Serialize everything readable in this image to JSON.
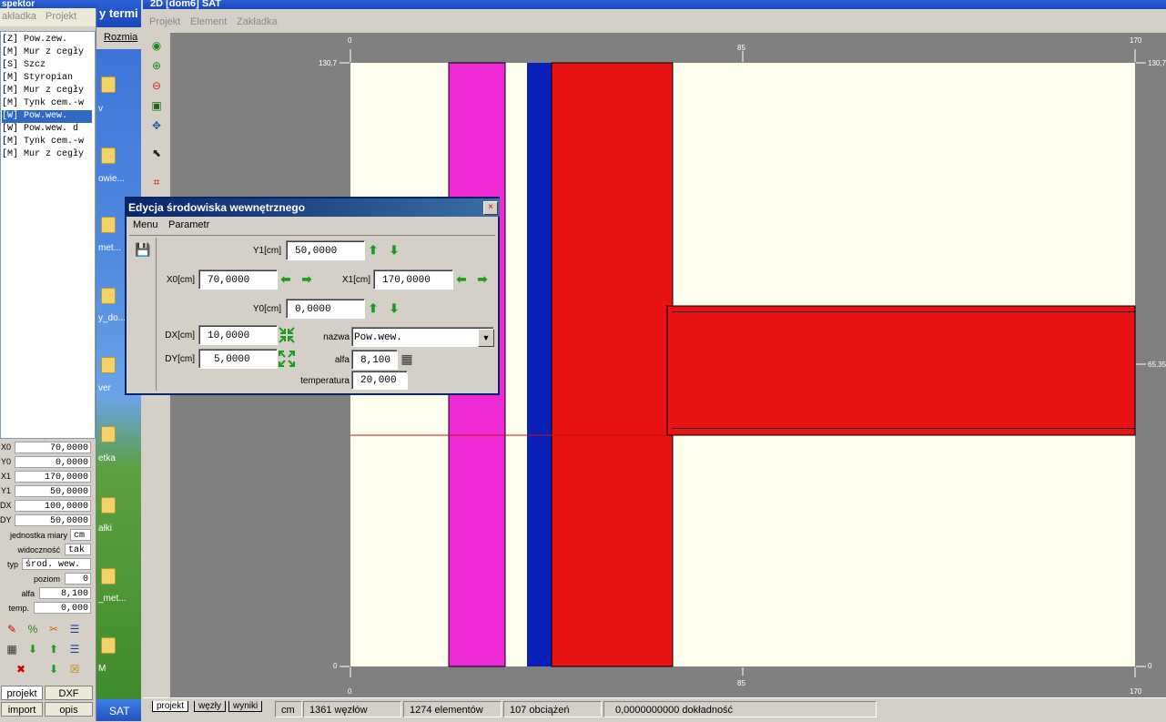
{
  "inspector": {
    "title": "spektor",
    "menu": [
      "akładka",
      "Projekt"
    ],
    "items": [
      {
        "label": "[Z] Pow.zew.",
        "selected": false
      },
      {
        "label": "[M] Mur z cegły",
        "selected": false
      },
      {
        "label": "[S] Szcz",
        "selected": false
      },
      {
        "label": "[M] Styropian",
        "selected": false
      },
      {
        "label": "[M] Mur z cegły",
        "selected": false
      },
      {
        "label": "[M] Tynk cem.-w",
        "selected": false
      },
      {
        "label": "[W] Pow.wew.",
        "selected": true
      },
      {
        "label": "[W] Pow.wew. d",
        "selected": false
      },
      {
        "label": "[M] Tynk cem.-w",
        "selected": false
      },
      {
        "label": "[M] Mur z cegły",
        "selected": false
      }
    ],
    "props": {
      "x0": {
        "label": "X0",
        "value": "70,0000"
      },
      "y0": {
        "label": "Y0",
        "value": "0,0000"
      },
      "x1": {
        "label": "X1",
        "value": "170,0000"
      },
      "y1": {
        "label": "Y1",
        "value": "50,0000"
      },
      "dx": {
        "label": "DX",
        "value": "100,0000"
      },
      "dy": {
        "label": "DY",
        "value": "50,0000"
      },
      "unit": {
        "label": "jednostka miary",
        "value": "cm"
      },
      "visibility": {
        "label": "widoczność",
        "value": "tak"
      },
      "type": {
        "label": "typ",
        "value": "środ. wew."
      },
      "level": {
        "label": "poziom",
        "value": "0"
      },
      "alfa": {
        "label": "alfa",
        "value": "8,100"
      },
      "temp": {
        "label": "temp.",
        "value": "0,000"
      }
    },
    "bottom_tabs": [
      "projekt",
      "DXF",
      "import",
      "opis"
    ]
  },
  "desktop": {
    "title_fragment": "y termi",
    "tab_fragment": "Rozmia",
    "icon_labels": [
      "v",
      "owie...",
      "met...",
      "y_do...",
      "ver",
      "etka",
      "ałki",
      "_met...",
      "M"
    ],
    "start_fragment": "SAT"
  },
  "main": {
    "title": "2D   [dom6]  SAT",
    "menu": [
      "Projekt",
      "Element",
      "Zakładka"
    ],
    "ruler": {
      "top": [
        "0",
        "85",
        "170"
      ],
      "left": [
        "130,7",
        "0"
      ],
      "right": [
        "130,7",
        "65,35",
        "0"
      ],
      "bottom": [
        "0",
        "85",
        "170"
      ]
    },
    "sheet_tabs": [
      "projekt",
      "węzły",
      "wyniki"
    ],
    "status": {
      "unit": "cm",
      "nodes": "1361 węzłów",
      "elements": "1274 elementów",
      "loads": "107 obciążeń",
      "accuracy": "0,0000000000 dokładność"
    }
  },
  "dialog": {
    "title": "Edycja środowiska wewnętrznego",
    "close": "×",
    "menu": [
      "Menu",
      "Parametr"
    ],
    "fields": {
      "y1": {
        "label": "Y1[cm]",
        "value": "50,0000"
      },
      "x0": {
        "label": "X0[cm]",
        "value": "70,0000"
      },
      "x1": {
        "label": "X1[cm]",
        "value": "170,0000"
      },
      "y0": {
        "label": "Y0[cm]",
        "value": "0,0000"
      },
      "dx": {
        "label": "DX[cm]",
        "value": "10,0000"
      },
      "dy": {
        "label": "DY[cm]",
        "value": "5,0000"
      },
      "nazwa": {
        "label": "nazwa",
        "value": "Pow.wew."
      },
      "alfa": {
        "label": "alfa",
        "value": "8,100"
      },
      "temperatura": {
        "label": "temperatura",
        "value": "20,000"
      }
    }
  },
  "colors": {
    "magenta_layer": "#ee2ad6",
    "blue_layer": "#0a1fb8",
    "red_layer": "#e81212",
    "background_layer": "#fffff0",
    "canvas_bg": "#808080",
    "selection": "#316ac5"
  }
}
